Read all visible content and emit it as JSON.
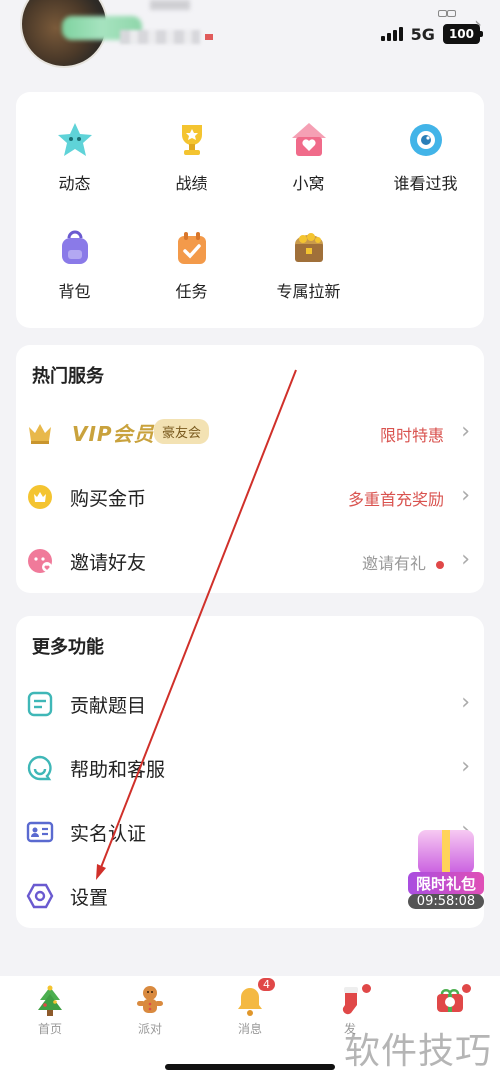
{
  "status_bar": {
    "network": "5G",
    "battery": "100"
  },
  "grid": [
    {
      "label": "动态",
      "icon": "star-face-icon",
      "color": "#5fd3d8"
    },
    {
      "label": "战绩",
      "icon": "trophy-icon",
      "color": "#f4c430"
    },
    {
      "label": "小窝",
      "icon": "house-heart-icon",
      "color": "#f06b8a"
    },
    {
      "label": "谁看过我",
      "icon": "eye-icon",
      "color": "#42b4e8"
    },
    {
      "label": "背包",
      "icon": "backpack-icon",
      "color": "#8a7ae8"
    },
    {
      "label": "任务",
      "icon": "calendar-check-icon",
      "color": "#f39a4a"
    },
    {
      "label": "专属拉新",
      "icon": "treasure-chest-icon",
      "color": "#c99a4a"
    }
  ],
  "hot_services": {
    "title": "热门服务",
    "vip": {
      "logo": "VIP会员",
      "badge": "豪友会",
      "right": "限时特惠"
    },
    "coins": {
      "label": "购买金币",
      "right": "多重首充奖励"
    },
    "invite": {
      "label": "邀请好友",
      "right": "邀请有礼"
    }
  },
  "more_features": {
    "title": "更多功能",
    "items": [
      {
        "label": "贡献题目"
      },
      {
        "label": "帮助和客服"
      },
      {
        "label": "实名认证"
      },
      {
        "label": "设置"
      }
    ]
  },
  "gift": {
    "label": "限时礼包",
    "timer": "09:58:08"
  },
  "bottom_nav": [
    {
      "label": "首页"
    },
    {
      "label": "派对"
    },
    {
      "label": "消息",
      "badge": "4"
    },
    {
      "label": "发"
    },
    {
      "label": ""
    }
  ],
  "watermark": "软件技巧",
  "colors": {
    "accent_red": "#d9534f",
    "vip_gold": "#c9a23d",
    "annotation": "#d0302a"
  }
}
